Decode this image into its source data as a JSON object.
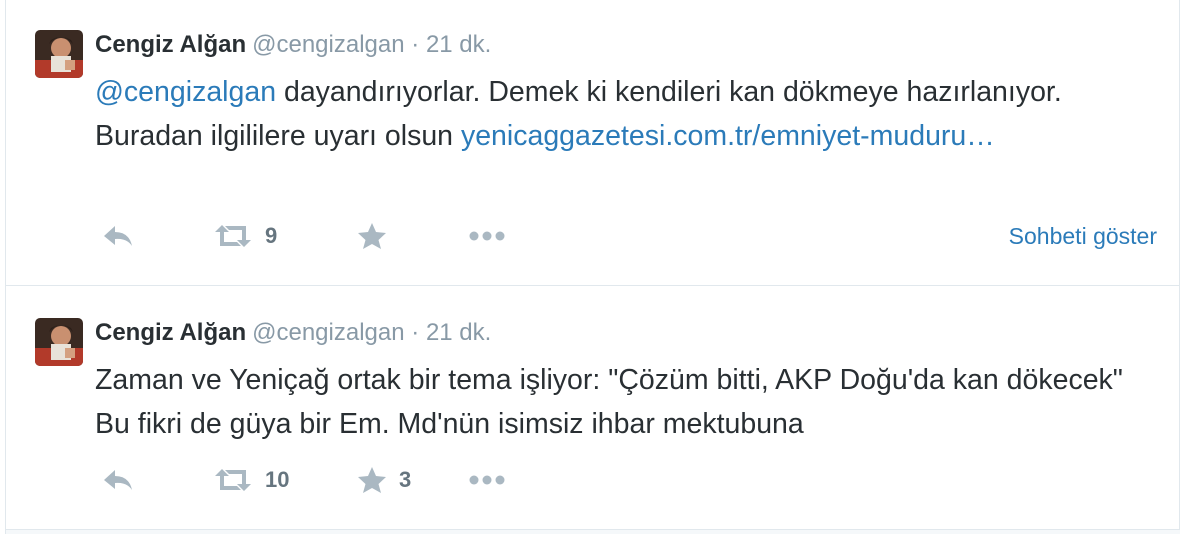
{
  "colors": {
    "link": "#2b7bb9",
    "text": "#292f33",
    "muted": "#8899a6",
    "border": "#e1e8ed"
  },
  "tweets": [
    {
      "fullname": "Cengiz Alğan",
      "username": "@cengizalgan",
      "dot": "·",
      "time": "21 dk.",
      "text_mention": "@cengizalgan",
      "text_body": " dayandırıyorlar. Demek ki kendileri kan dökmeye hazırlanıyor. Buradan ilgililere uyarı olsun ",
      "text_link": "yenicaggazetesi.com.tr/emniyet-muduru…",
      "retweet_count": "9",
      "favorite_count": "",
      "show_conversation": "Sohbeti göster",
      "icons": [
        "reply-icon",
        "retweet-icon",
        "favorite-icon",
        "more-icon"
      ]
    },
    {
      "fullname": "Cengiz Alğan",
      "username": "@cengizalgan",
      "dot": "·",
      "time": "21 dk.",
      "text_body": "Zaman ve Yeniçağ ortak bir tema işliyor: \"Çözüm bitti, AKP Doğu'da kan dökecek\" Bu fikri de güya bir Em. Md'nün isimsiz ihbar mektubuna",
      "retweet_count": "10",
      "favorite_count": "3",
      "icons": [
        "reply-icon",
        "retweet-icon",
        "favorite-icon",
        "more-icon"
      ]
    }
  ]
}
